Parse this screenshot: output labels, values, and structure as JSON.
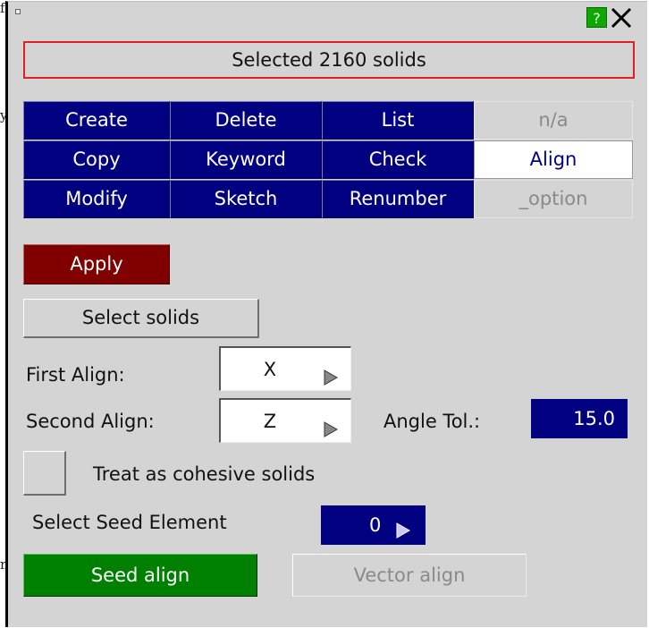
{
  "background_fragments": [
    "f",
    "y",
    "n"
  ],
  "window": {
    "help_label": "?",
    "close_icon": "close-icon"
  },
  "status": "Selected 2160 solids",
  "ops_grid": [
    [
      {
        "label": "Create",
        "state": "normal"
      },
      {
        "label": "Delete",
        "state": "normal"
      },
      {
        "label": "List",
        "state": "normal"
      },
      {
        "label": "n/a",
        "state": "disabled"
      }
    ],
    [
      {
        "label": "Copy",
        "state": "normal"
      },
      {
        "label": "Keyword",
        "state": "normal"
      },
      {
        "label": "Check",
        "state": "normal"
      },
      {
        "label": "Align",
        "state": "selected"
      }
    ],
    [
      {
        "label": "Modify",
        "state": "normal"
      },
      {
        "label": "Sketch",
        "state": "normal"
      },
      {
        "label": "Renumber",
        "state": "normal"
      },
      {
        "label": "_option",
        "state": "disabled"
      }
    ]
  ],
  "apply_label": "Apply",
  "select_solids_label": "Select solids",
  "first_align": {
    "label": "First Align:",
    "value": "X"
  },
  "second_align": {
    "label": "Second Align:",
    "value": "Z"
  },
  "angle_tol": {
    "label": "Angle Tol.:",
    "value": "15.0"
  },
  "cohesive": {
    "label": "Treat as cohesive solids",
    "checked": false
  },
  "seed_element": {
    "label": "Select Seed Element",
    "value": "0"
  },
  "seed_align_label": "Seed align",
  "vector_align_label": "Vector align",
  "colors": {
    "panel_bg": "#d4d4d4",
    "button_blue": "#000080",
    "apply_red": "#800000",
    "seed_green": "#008000",
    "status_border": "#e02020",
    "help_green": "#0da800"
  }
}
